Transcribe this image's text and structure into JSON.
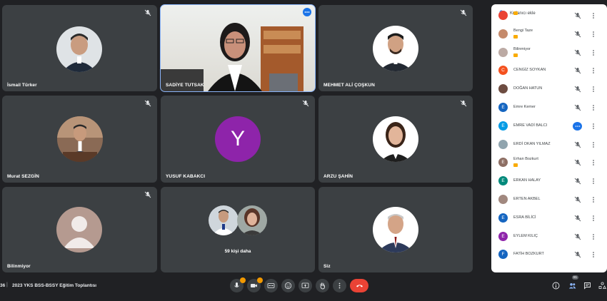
{
  "tiles": [
    {
      "name": "İsmail Türker"
    },
    {
      "name": "SADİYE TUTSAK"
    },
    {
      "name": "MEHMET ALİ ÇOŞKUN"
    },
    {
      "name": "Murat SEZGİN"
    },
    {
      "name": "YUSUF KABAKCI",
      "initial": "Y"
    },
    {
      "name": "ARZU ŞAHİN"
    },
    {
      "name": "Bilinmiyor"
    },
    {
      "name": "",
      "others": "59 kişi daha"
    },
    {
      "name": "Siz"
    }
  ],
  "panel": {
    "add_people": "Kullanıcı ekle",
    "participants": [
      {
        "name": "",
        "initial": "",
        "color": "#ea4335"
      },
      {
        "name": "Bengi Taze",
        "initial": "",
        "color": "#c58a6b"
      },
      {
        "name": "Bilinmiyor",
        "initial": "",
        "color": "#bcaaa4"
      },
      {
        "name": "CENGİZ SOYKAN",
        "initial": "C",
        "color": "#f4511e"
      },
      {
        "name": "DOĞAN HATUN",
        "initial": "",
        "color": "#6d4c41"
      },
      {
        "name": "Emre Kemer",
        "initial": "E",
        "color": "#1565c0"
      },
      {
        "name": "EMRE VADİ BALCI",
        "initial": "E",
        "color": "#039be5"
      },
      {
        "name": "ERDİ OKAN YILMAZ",
        "initial": "",
        "color": "#90a4ae"
      },
      {
        "name": "Erhan Bozkurt",
        "initial": "E",
        "color": "#8d6e63"
      },
      {
        "name": "ERKAN HALAY",
        "initial": "E",
        "color": "#00897b"
      },
      {
        "name": "ERTEN AKBEL",
        "initial": "",
        "color": "#a1887f"
      },
      {
        "name": "ESRA BİLİCİ",
        "initial": "E",
        "color": "#1565c0"
      },
      {
        "name": "EYLEM KILIÇ",
        "initial": "E",
        "color": "#8e24aa"
      },
      {
        "name": "FATİH BOZKURT",
        "initial": "F",
        "color": "#1565c0"
      }
    ]
  },
  "bottom": {
    "time": "36",
    "separator": "|",
    "title": "2023 YKS BSS-BSSY Eğitim Toplantısı",
    "participant_count": "81"
  },
  "colors": {
    "background": "#202124",
    "tile": "#3c4043",
    "accent": "#1a73e8",
    "end_call": "#ea4335",
    "yusuf_avatar": "#8e24aa"
  }
}
